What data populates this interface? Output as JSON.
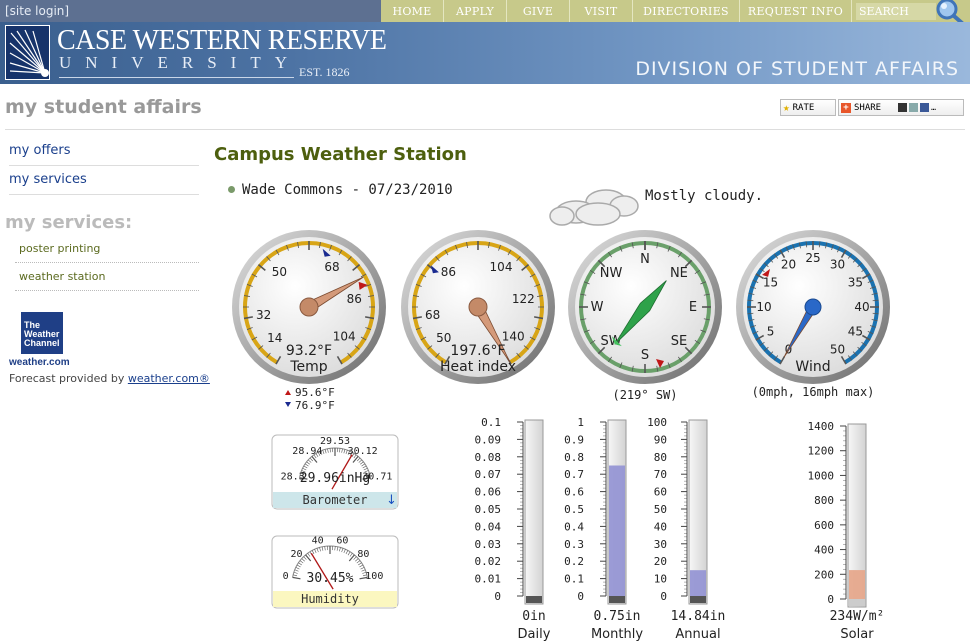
{
  "topbar": {
    "site_login": "[site login]",
    "nav": [
      "HOME",
      "APPLY",
      "GIVE",
      "VISIT",
      "DIRECTORIES",
      "REQUEST INFO"
    ],
    "search_placeholder": "SEARCH"
  },
  "banner": {
    "university_name": "CASE WESTERN RESERVE",
    "university_sub": "UNIVERSITY",
    "est": "EST. 1826",
    "division": "DIVISION OF STUDENT AFFAIRS"
  },
  "header": {
    "page_title": "my student affairs",
    "rate_label": "RATE",
    "share_label": "SHARE"
  },
  "sidebar": {
    "links": [
      "my offers",
      "my services"
    ],
    "heading": "my services:",
    "sub_links": [
      "poster printing",
      "weather station"
    ],
    "twc_logo_lines": [
      "The",
      "Weather",
      "Channel"
    ],
    "twc_url": "weather.com",
    "credit_text": "Forecast provided by",
    "credit_link": "weather.com®"
  },
  "main": {
    "title": "Campus Weather Station",
    "location": "Wade Commons - 07/23/2010",
    "condition": "Mostly cloudy."
  },
  "gauges": {
    "temp": {
      "ticks": [
        "14",
        "32",
        "50",
        "68",
        "86",
        "104"
      ],
      "value_label": "93.2°F",
      "name": "Temp",
      "value": 93.2,
      "high": "95.6°F",
      "low": "76.9°F",
      "high_value": 95.6,
      "low_value": 76.9
    },
    "heat": {
      "ticks": [
        "50",
        "68",
        "86",
        "104",
        "122",
        "140"
      ],
      "value_label": "197.6°F",
      "name": "Heat index",
      "value": 197.6
    },
    "wind_dir": {
      "ticks": [
        "N",
        "NE",
        "E",
        "SE",
        "S",
        "SW",
        "W",
        "NW"
      ],
      "caption": "(219° SW)",
      "degrees": 219
    },
    "wind": {
      "ticks": [
        "0",
        "5",
        "10",
        "15",
        "20",
        "25",
        "30",
        "35",
        "40",
        "45",
        "50"
      ],
      "name": "Wind",
      "caption": "(0mph, 16mph max)",
      "speed": 0,
      "max": 16
    },
    "barometer": {
      "ticks": [
        "28.3",
        "28.94",
        "29.53",
        "30.12",
        "30.71"
      ],
      "value_label": "29.96inHg",
      "name": "Barometer",
      "value": 29.96,
      "trend_icon": "arrow-down-icon"
    },
    "humidity": {
      "ticks": [
        "0",
        "20",
        "40",
        "60",
        "80",
        "100"
      ],
      "value_label": "30.45%",
      "name": "Humidity",
      "value": 30.45
    }
  },
  "rain": {
    "daily": {
      "ticks": [
        "0",
        "0.01",
        "0.02",
        "0.03",
        "0.04",
        "0.05",
        "0.06",
        "0.07",
        "0.08",
        "0.09",
        "0.1"
      ],
      "value_label": "0in",
      "name": "Daily",
      "value": 0,
      "max": 0.1
    },
    "monthly": {
      "ticks": [
        "0",
        "0.1",
        "0.2",
        "0.3",
        "0.4",
        "0.5",
        "0.6",
        "0.7",
        "0.8",
        "0.9",
        "1"
      ],
      "value_label": "0.75in",
      "name": "Monthly",
      "value": 0.75,
      "max": 1
    },
    "annual": {
      "ticks": [
        "0",
        "10",
        "20",
        "30",
        "40",
        "50",
        "60",
        "70",
        "80",
        "90",
        "100"
      ],
      "value_label": "14.84in",
      "name": "Annual",
      "value": 14.84,
      "max": 100
    }
  },
  "solar": {
    "ticks": [
      "0",
      "200",
      "400",
      "600",
      "800",
      "1000",
      "1200",
      "1400"
    ],
    "value_label": "234W/m²",
    "name": "Solar",
    "value": 234,
    "max": 1400
  },
  "colors": {
    "nav_bg": "#c7c98a",
    "topbar": "#5d7091",
    "title_green": "#4d5f0e",
    "link_blue": "#1a3f8c",
    "gauge_ring": "#d8a516",
    "compass_ring": "#6aa06a",
    "wind_ring": "#1a72b0",
    "rain_fill": "#9696d4",
    "solar_fill": "#e6a88c"
  }
}
